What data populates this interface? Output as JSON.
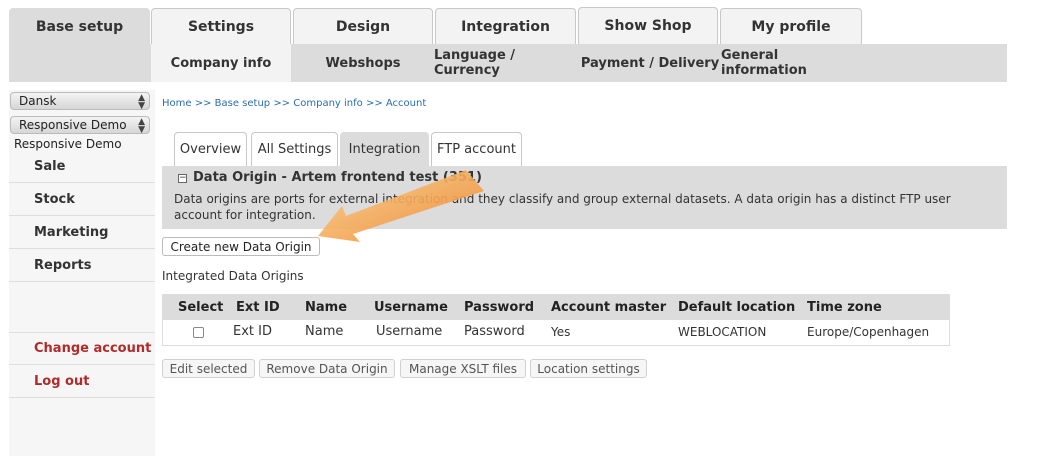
{
  "top_tabs": [
    {
      "label": "Base setup",
      "active": true
    },
    {
      "label": "Settings"
    },
    {
      "label": "Design"
    },
    {
      "label": "Integration"
    },
    {
      "label": "Show Shop"
    },
    {
      "label": "My profile"
    }
  ],
  "sub_tabs": [
    {
      "label": "Company info",
      "active": true
    },
    {
      "label": "Webshops"
    },
    {
      "label": "Language / Currency"
    },
    {
      "label": "Payment / Delivery"
    },
    {
      "label": "General information"
    }
  ],
  "sidebar": {
    "language_select": "Dansk",
    "shop_select": "Responsive Demo",
    "shop_name": "Responsive Demo",
    "items": [
      "Sale",
      "Stock",
      "Marketing",
      "Reports"
    ],
    "account_items": [
      "Change account",
      "Log out"
    ],
    "account_color": "#b22a2a"
  },
  "breadcrumb": "Home >> Base setup >> Company info >> Account",
  "inner_tabs": [
    {
      "label": "Overview"
    },
    {
      "label": "All Settings"
    },
    {
      "label": "Integration",
      "active": true
    },
    {
      "label": "FTP account"
    }
  ],
  "panel": {
    "toggle": "−",
    "title": "Data Origin - Artem frontend test (351)",
    "description": "Data origins are ports for external integration and they classify and group external datasets. A data origin has a distinct FTP user account for integration."
  },
  "create_button": "Create new Data Origin",
  "integrated_label": "Integrated Data Origins",
  "table": {
    "headers": [
      "Select",
      "Ext ID",
      "Name",
      "Username",
      "Password",
      "Account master",
      "Default location",
      "Time zone"
    ],
    "row": [
      "",
      "Ext ID",
      "Name",
      "Username",
      "Password",
      "Yes",
      "WEBLOCATION",
      "Europe/Copenhagen"
    ]
  },
  "actions": [
    "Edit selected",
    "Remove Data Origin",
    "Manage XSLT files",
    "Location settings"
  ],
  "colors": {
    "accent_arrow": "#f0862c",
    "link": "#2a6db0",
    "panel_bg": "#dcdcdc"
  }
}
